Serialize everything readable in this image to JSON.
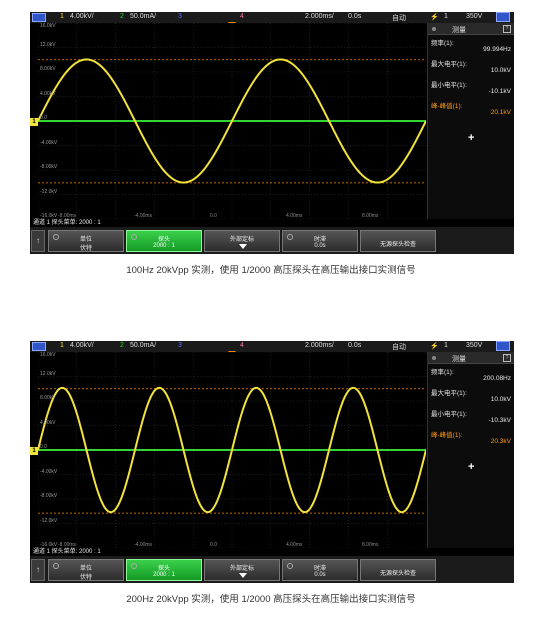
{
  "panels": [
    {
      "status": {
        "ch1_num": "1",
        "ch1_scale": "4.00kV/",
        "ch2_num": "2",
        "ch2_scale": "50.0mA/",
        "ch3_num": "3",
        "ch4_num": "4",
        "timebase": "2.000ms/",
        "delay": "0.0s",
        "mode": "自动",
        "trig_src": "1",
        "trig_level": "350V"
      },
      "y_labels": [
        "16.0kV",
        "12.0kV",
        "8.00kV",
        "4.00kV",
        "0.0",
        "-4.00kV",
        "-8.00kV",
        "-12.0kV",
        "-16.0kV"
      ],
      "x_labels": [
        "-8.00ms",
        "-4.00ms",
        "0.0",
        "4.00ms",
        "8.00ms"
      ],
      "ch_tag": "1",
      "measure": {
        "header": "测量",
        "rows": [
          {
            "name": "频率(1):",
            "value": "99.994Hz"
          },
          {
            "name": "最大电平(1):",
            "value": "10.0kV"
          },
          {
            "name": "最小电平(1):",
            "value": "-10.1kV"
          },
          {
            "name": "峰-峰值(1):",
            "value": "20.1kV"
          }
        ],
        "add": "+"
      },
      "menu_title": "通道 1 探头菜单: 2000 : 1",
      "softkeys": [
        {
          "l1": "单位",
          "l2": "伏特"
        },
        {
          "l1": "探头",
          "l2": "2000 : 1"
        },
        {
          "l1": "外部定标",
          "l2": ""
        },
        {
          "l1": "时滞",
          "l2": "0.0s"
        },
        {
          "l1": "无源探头检查",
          "l2": ""
        }
      ],
      "back": "↑",
      "waveform": {
        "cycles_on_screen": 2,
        "amplitude_kv": 10.05,
        "probe_ratio": "2000 : 1"
      }
    },
    {
      "status": {
        "ch1_num": "1",
        "ch1_scale": "4.00kV/",
        "ch2_num": "2",
        "ch2_scale": "50.0mA/",
        "ch3_num": "3",
        "ch4_num": "4",
        "timebase": "2.000ms/",
        "delay": "0.0s",
        "mode": "自动",
        "trig_src": "1",
        "trig_level": "350V"
      },
      "y_labels": [
        "16.0kV",
        "12.0kV",
        "8.00kV",
        "4.00kV",
        "0.0",
        "-4.00kV",
        "-8.00kV",
        "-12.0kV",
        "-16.0kV"
      ],
      "x_labels": [
        "-8.00ms",
        "-4.00ms",
        "0.0",
        "4.00ms",
        "8.00ms"
      ],
      "ch_tag": "1",
      "measure": {
        "header": "测量",
        "rows": [
          {
            "name": "频率(1):",
            "value": "200.08Hz"
          },
          {
            "name": "最大电平(1):",
            "value": "10.0kV"
          },
          {
            "name": "最小电平(1):",
            "value": "-10.3kV"
          },
          {
            "name": "峰-峰值(1):",
            "value": "20.3kV"
          }
        ],
        "add": "+"
      },
      "menu_title": "通道 1 探头菜单: 2000 : 1",
      "softkeys": [
        {
          "l1": "单位",
          "l2": "伏特"
        },
        {
          "l1": "探头",
          "l2": "2000 : 1"
        },
        {
          "l1": "外部定标",
          "l2": ""
        },
        {
          "l1": "时滞",
          "l2": "0.0s"
        },
        {
          "l1": "无源探头检查",
          "l2": ""
        }
      ],
      "back": "↑",
      "waveform": {
        "cycles_on_screen": 4,
        "amplitude_kv": 10.15,
        "probe_ratio": "2000 : 1"
      }
    }
  ],
  "captions": [
    "100Hz 20kVpp 实测，使用 1/2000 高压探头在高压输出接口实测信号",
    "200Hz 20kVpp 实测，使用 1/2000 高压探头在高压输出接口实测信号"
  ],
  "colors": {
    "ch1": "#f2e33a",
    "ch2": "#33d433",
    "cursor": "#ff8a00",
    "grid": "#3a3a3a"
  }
}
